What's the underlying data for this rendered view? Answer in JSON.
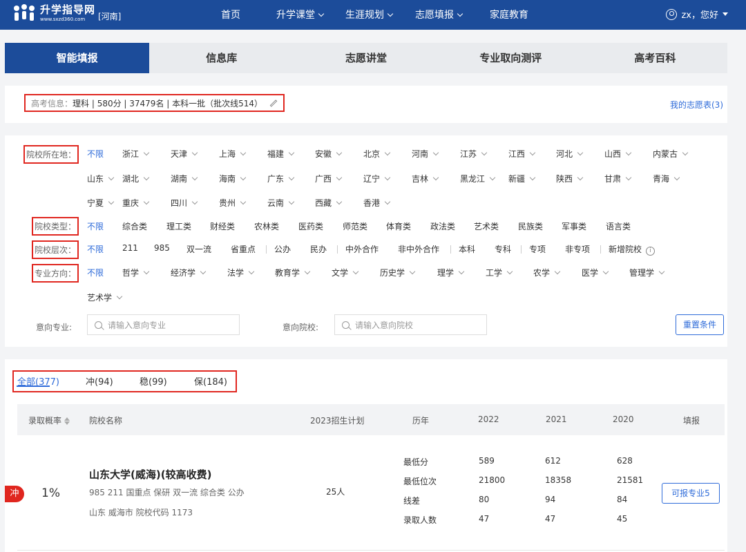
{
  "header": {
    "logo_name": "升学指导网",
    "logo_url": "www.sxzd360.com",
    "region": "[河南]",
    "nav": [
      {
        "label": "首页",
        "dropdown": false
      },
      {
        "label": "升学课堂",
        "dropdown": true
      },
      {
        "label": "生涯规划",
        "dropdown": true
      },
      {
        "label": "志愿填报",
        "dropdown": true
      },
      {
        "label": "家庭教育",
        "dropdown": false
      }
    ],
    "user": "zx，您好"
  },
  "tabs": [
    "智能填报",
    "信息库",
    "志愿讲堂",
    "专业取向测评",
    "高考百科"
  ],
  "active_tab": "智能填报",
  "info": {
    "label": "高考信息：",
    "value": "理科 | 580分 | 37479名 | 本科一批（批次线514）",
    "my_list": "我的志愿表(3)"
  },
  "filters": {
    "location_label": "院校所在地：",
    "location_rows": [
      [
        "不限",
        "浙江",
        "天津",
        "上海",
        "福建",
        "安徽",
        "北京",
        "河南",
        "江苏",
        "江西",
        "河北",
        "山西",
        "内蒙古"
      ],
      [
        "山东",
        "湖北",
        "湖南",
        "海南",
        "广东",
        "广西",
        "辽宁",
        "吉林",
        "黑龙江",
        "新疆",
        "陕西",
        "甘肃",
        "青海"
      ],
      [
        "宁夏",
        "重庆",
        "四川",
        "贵州",
        "云南",
        "西藏",
        "香港"
      ]
    ],
    "type_label": "院校类型：",
    "types": [
      "不限",
      "综合类",
      "理工类",
      "财经类",
      "农林类",
      "医药类",
      "师范类",
      "体育类",
      "政法类",
      "艺术类",
      "民族类",
      "军事类",
      "语言类"
    ],
    "level_label": "院校层次：",
    "levels": [
      "不限",
      "211",
      "985",
      "双一流",
      "省重点",
      "公办",
      "民办",
      "中外合作",
      "非中外合作",
      "本科",
      "专科",
      "专项",
      "非专项",
      "新增院校"
    ],
    "major_label": "专业方向：",
    "majors": [
      "不限",
      "哲学",
      "经济学",
      "法学",
      "教育学",
      "文学",
      "历史学",
      "理学",
      "工学",
      "农学",
      "医学",
      "管理学",
      "艺术学"
    ],
    "intent_major_label": "意向专业:",
    "intent_major_placeholder": "请输入意向专业",
    "intent_school_label": "意向院校:",
    "intent_school_placeholder": "请输入意向院校",
    "reset": "重置条件"
  },
  "categories": [
    "全部(377)",
    "冲(94)",
    "稳(99)",
    "保(184)"
  ],
  "table": {
    "headers": {
      "prob": "录取概率",
      "name": "院校名称",
      "plan": "2023招生计划",
      "history": "历年",
      "y2022": "2022",
      "y2021": "2021",
      "y2020": "2020",
      "apply": "填报"
    },
    "rows": [
      {
        "tag": "冲",
        "prob": "1%",
        "name": "山东大学(威海)(较高收费)",
        "tags": "985 211 国重点 保研 双一流 综合类 公办",
        "location": "山东 威海市  院校代码 1173",
        "plan": "25人",
        "history": [
          {
            "label": "最低分",
            "y2022": "589",
            "y2021": "612",
            "y2020": "628"
          },
          {
            "label": "最低位次",
            "y2022": "21800",
            "y2021": "18358",
            "y2020": "21581"
          },
          {
            "label": "线差",
            "y2022": "80",
            "y2021": "94",
            "y2020": "84"
          },
          {
            "label": "录取人数",
            "y2022": "47",
            "y2021": "47",
            "y2020": "45"
          }
        ],
        "apply": "可报专业5"
      }
    ]
  }
}
